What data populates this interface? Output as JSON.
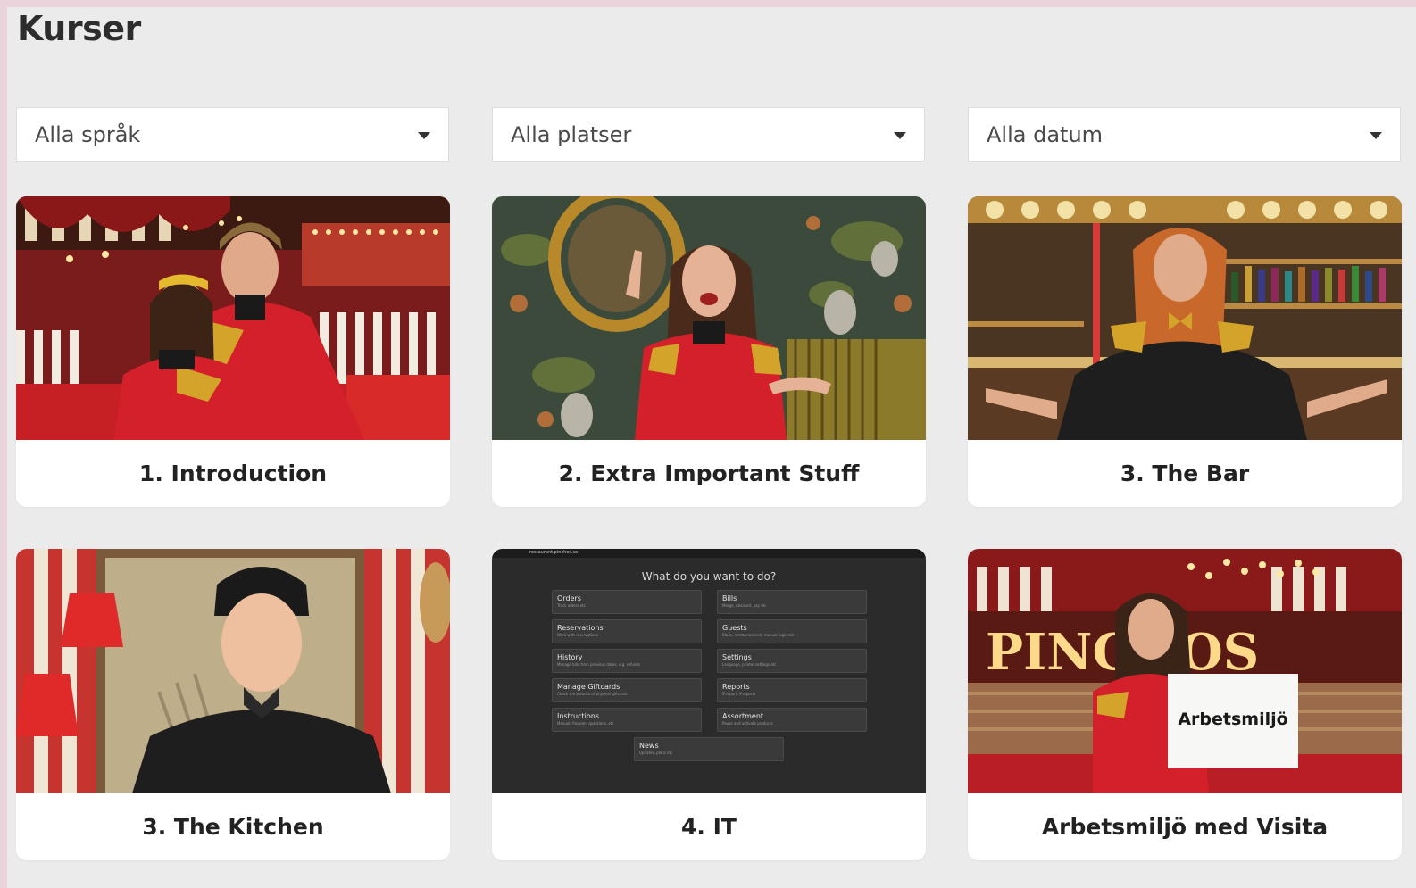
{
  "page": {
    "title": "Kurser"
  },
  "filters": [
    {
      "label": "Alla språk"
    },
    {
      "label": "Alla platser"
    },
    {
      "label": "Alla datum"
    }
  ],
  "courses": [
    {
      "title": "1. Introduction"
    },
    {
      "title": "2. Extra Important Stuff"
    },
    {
      "title": "3. The Bar"
    },
    {
      "title": "3. The Kitchen"
    },
    {
      "title": "4. IT"
    },
    {
      "title": "Arbetsmiljö med Visita"
    }
  ],
  "it_thumbnail": {
    "url": "restaurant.pinchos.se",
    "heading": "What do you want to do?",
    "tiles": [
      {
        "title": "Orders",
        "sub": "Track orders etc"
      },
      {
        "title": "Bills",
        "sub": "Merge, discount, pay etc"
      },
      {
        "title": "Reservations",
        "sub": "Work with reservations"
      },
      {
        "title": "Guests",
        "sub": "Block, reimbursement, manual login etc"
      },
      {
        "title": "History",
        "sub": "Manage bills from previous dates, e.g. refunds"
      },
      {
        "title": "Settings",
        "sub": "Language, printer settings etc"
      },
      {
        "title": "Manage Giftcards",
        "sub": "Check the balance of physical giftcards"
      },
      {
        "title": "Reports",
        "sub": "Z-report, X-reports"
      },
      {
        "title": "Instructions",
        "sub": "Manual, frequent questions, etc"
      },
      {
        "title": "Assortment",
        "sub": "Pause and activate products"
      },
      {
        "title": "News",
        "sub": "Updates, plans etc"
      }
    ]
  },
  "sign_text": "Arbetsmiljö",
  "colors": {
    "uniform_red": "#d3202a",
    "gold": "#d4a42a",
    "page_bg": "#ebebeb"
  }
}
